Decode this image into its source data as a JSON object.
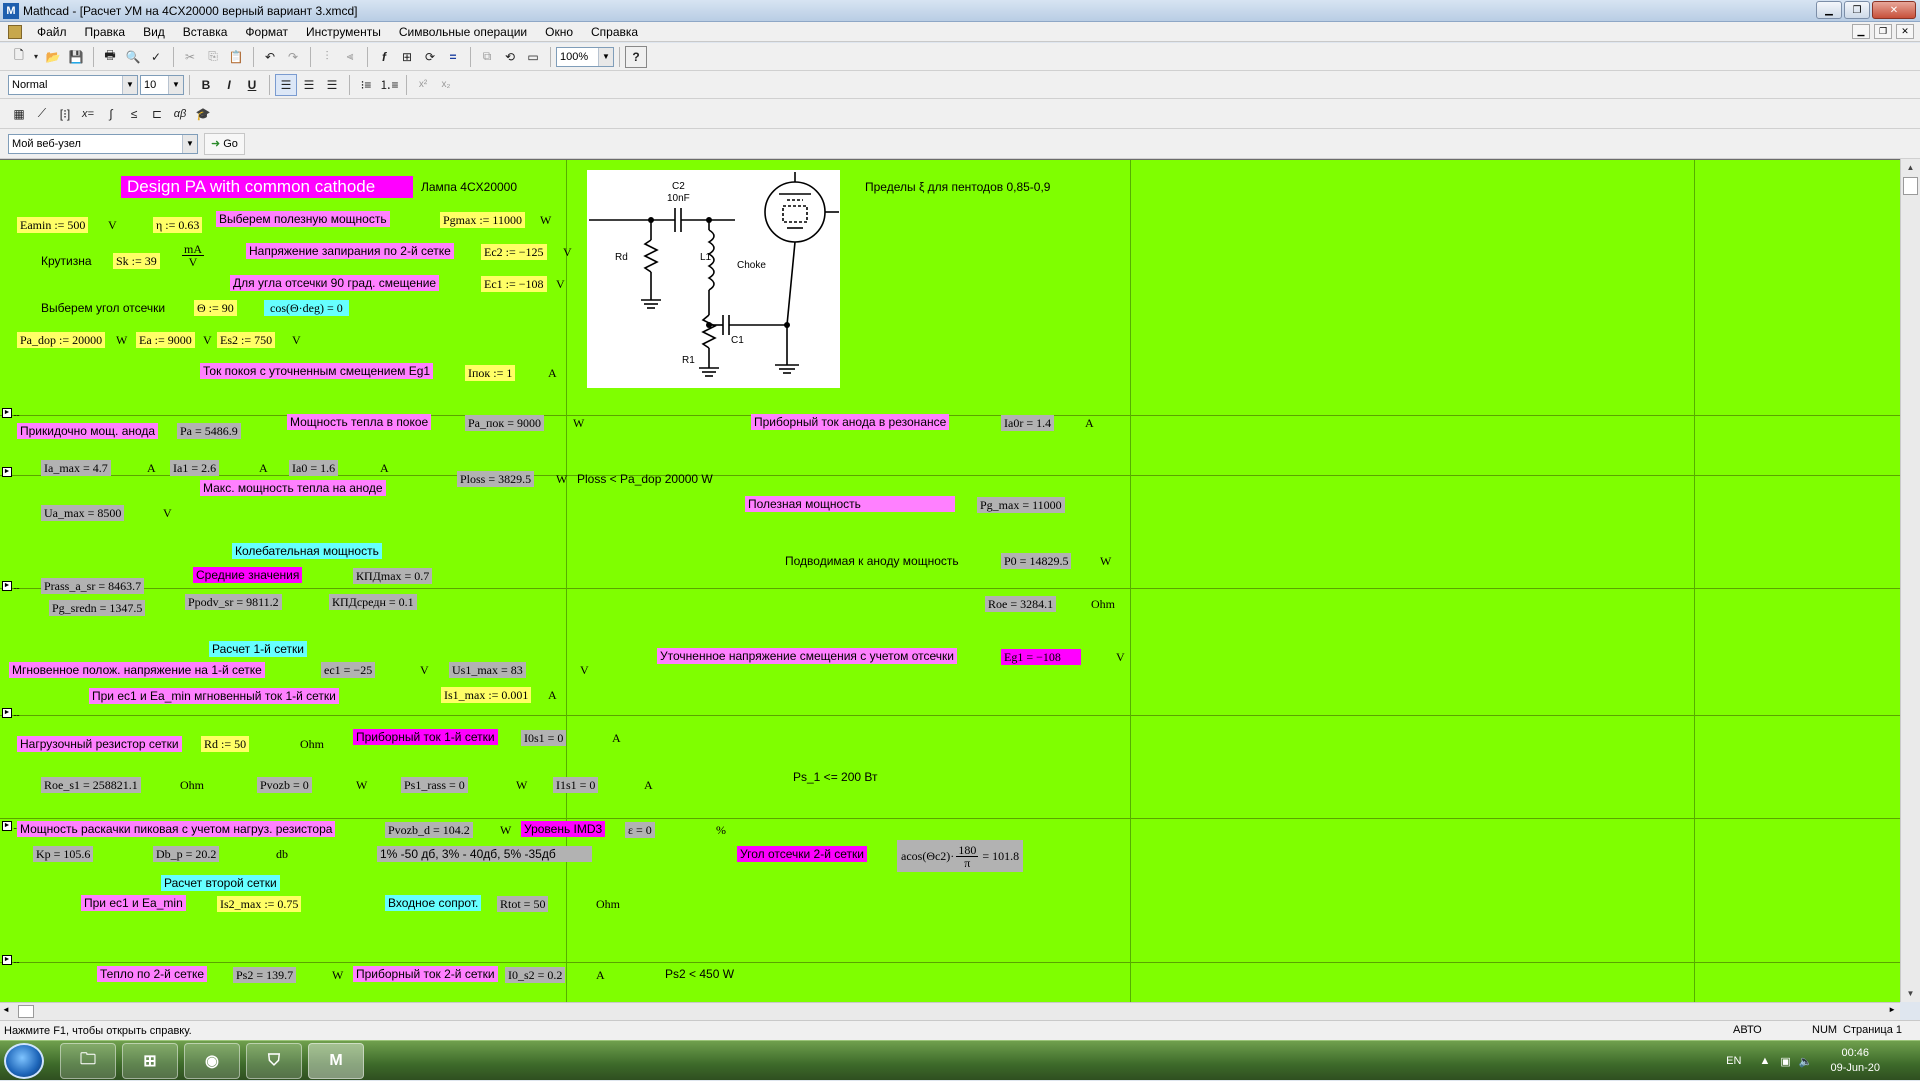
{
  "window": {
    "title": "Mathcad - [Расчет УМ на 4CX20000  верный вариант 3.xmcd]",
    "icon": "mathcad-icon",
    "controls": [
      "minimize",
      "maximize",
      "close"
    ]
  },
  "menu": [
    "Файл",
    "Правка",
    "Вид",
    "Вставка",
    "Формат",
    "Инструменты",
    "Символьные операции",
    "Окно",
    "Справка"
  ],
  "toolbar": {
    "zoom": "100%",
    "style": "Normal",
    "font_size": "10",
    "bold": "B",
    "italic": "I",
    "underline": "U",
    "superscript": "x²",
    "subscript": "x₂",
    "math_ops": [
      "x=",
      "f(x)",
      "αβ"
    ],
    "web_location": "Мой веб-узел",
    "go": "Go"
  },
  "sheet": {
    "title": "Design PA with common cathode",
    "lamp": "Лампа 4CX20000",
    "limits": "Пределы ξ для пентодов  0,85-0,9",
    "eamin": "Eamin := 500",
    "eta": "η := 0.63",
    "choose_power": "Выберем полезную мощность",
    "pgmax": "Pgmax := 11000",
    "steepness": "Крутизна",
    "sk": "Sk := 39",
    "sk_num": "mA",
    "sk_den": "V",
    "cutoff_g2": "Напряжение запирания по 2-й сетке",
    "ec2": "Ec2 := −125",
    "bias90": "Для угла отсечки 90 град. смещение",
    "ec1": "Ec1 := −108",
    "choose_angle": "Выберем угол отсечки",
    "theta": "Θ := 90",
    "cos": "cos(Θ·deg) = 0",
    "pa_dop": "Pa_dop := 20000",
    "ea": "Ea := 9000",
    "es2": "Es2 := 750",
    "quiescent": "Ток покоя с уточненным смещением Eg1",
    "ipok": "Iпок := 1",
    "pa_label": "Прикидочно мощ. анода",
    "pa": "Pa = 5486.9",
    "idle_heat": "Мощность тепла в покое",
    "pa_pok": "Pa_пок = 9000",
    "res_current": "Приборный ток анода  в резонансе",
    "ia0r": "Ia0r = 1.4",
    "ia_max": "Ia_max = 4.7",
    "ia1": "Ia1 = 2.6",
    "ia0": "Ia0 = 1.6",
    "max_heat": "Макс. мощность тепла на аноде",
    "ploss": "Ploss = 3829.5",
    "ploss_note": "Ploss < Pa_dop 20000 W",
    "ua_max": "Ua_max = 8500",
    "useful_power": "Полезная мощность",
    "pg_max": "Pg_max = 11000",
    "osc_power": "Колебательная мощность",
    "avg_values": "Средние значения",
    "kpd_max": "КПДmax = 0.7",
    "supplied_power": "Подводимая к аноду мощность",
    "p0": "P0 = 14829.5",
    "prass": "Prass_a_sr = 8463.7",
    "pg_sredn": "Pg_sredn = 1347.5",
    "ppodv": "Ppodv_sr = 9811.2",
    "kpd_sredn": "КПДсредн = 0.1",
    "roe": "Roe = 3284.1",
    "calc_g1": "Расчет 1-й сетки",
    "refined_bias": "Уточненное напряжение смещения с учетом отсечки",
    "eg1": "Eg1 = −108",
    "inst_pos": "Мгновенное полож. напряжение на 1-й сетке",
    "ec1_val": "ec1 = −25",
    "us1_max": "Us1_max = 83",
    "inst_current_g1": "При ec1  и Ea_min мгновенный ток 1-й сетки",
    "is1_max": "Is1_max := 0.001",
    "load_res": "Нагрузочный резистор сетки",
    "rd": "Rd := 50",
    "dev_current_g1": "Приборный ток 1-й сетки",
    "i0s1": "I0s1 = 0",
    "roe_s1": "Roe_s1 = 258821.1",
    "pvozb": "Pvozb = 0",
    "ps1_rass": "Ps1_rass = 0",
    "i1s1": "I1s1 = 0",
    "ps1_note": "Ps_1 <= 200 Вт",
    "drive_peak": "Мощность раскачки пиковая с учетом нагруз. резистора",
    "pvozb_d": "Pvozb_d = 104.2",
    "imd3": "Уровень IMD3",
    "eps": "ε = 0",
    "pct": "%",
    "kp": "Kp = 105.6",
    "db_p": "Db_p = 20.2",
    "db": "db",
    "imd_note": "1% -50 дб, 3% - 40дб, 5% -35дб",
    "angle_g2": "Угол отсечки 2-й сетки",
    "acos_head": "acos(Θc2)·",
    "acos_num": "180",
    "acos_den": "π",
    "acos_val": "= 101.8",
    "calc_g2": "Расчет второй сетки",
    "at_ec1": "При ec1 и Ea_min",
    "is2_max": "Is2_max := 0.75",
    "input_res": "Входное сопрот.",
    "rtot": "Rtot = 50",
    "heat_g2": "Тепло по 2-й сетке",
    "ps2": "Ps2 = 139.7",
    "dev_current_g2": "Приборный ток 2-й сетки",
    "i0_s2": "I0_s2 = 0.2",
    "ps2_note": "Ps2 < 450 W",
    "u_V": "V",
    "u_W": "W",
    "u_A": "A",
    "u_Ohm": "Ohm"
  },
  "schematic": {
    "c2": "C2",
    "c2_val": "10nF",
    "rd": "Rd",
    "l1": "L1",
    "choke": "Choke",
    "r1": "R1",
    "c1": "C1"
  },
  "status": {
    "help": "Нажмите F1, чтобы открыть справку.",
    "mode": "АВТО",
    "num": "NUM",
    "page": "Страница 1"
  },
  "taskbar": {
    "lang": "EN",
    "time": "00:46",
    "date": "09-Jun-20"
  }
}
